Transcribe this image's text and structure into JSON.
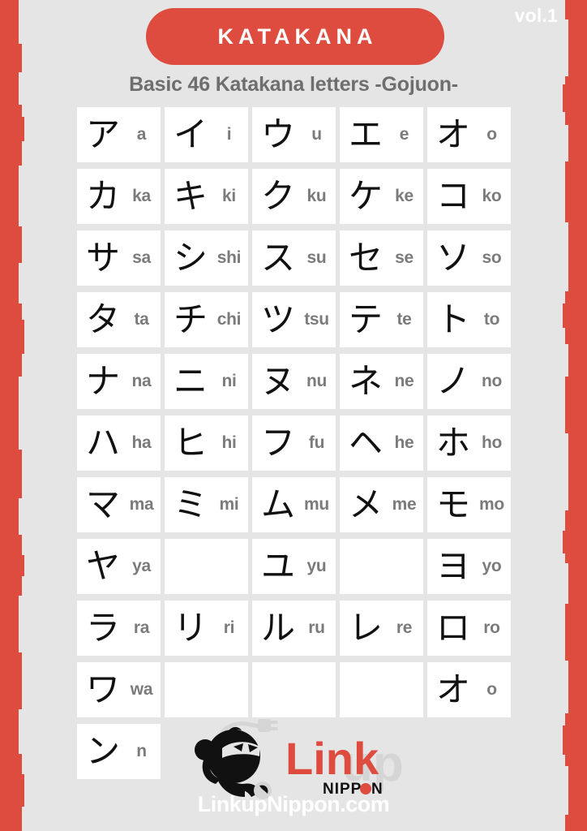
{
  "header": {
    "volume": "vol.1",
    "title": "KATAKANA",
    "subtitle": "Basic 46 Katakana letters -Gojuon-"
  },
  "colors": {
    "background": "#e6e5e5",
    "accent_red": "#dd4c3e",
    "cell_background": "#ffffff",
    "kana_text": "#111111",
    "romaji_text": "#7b7b7b",
    "subtitle_text": "#6e6e6e",
    "logo_black": "#111111",
    "logo_gray": "#d6d5d5"
  },
  "grid": {
    "columns": 5,
    "rows": [
      {
        "cells": [
          {
            "kana": "ア",
            "romaji": "a"
          },
          {
            "kana": "イ",
            "romaji": "i"
          },
          {
            "kana": "ウ",
            "romaji": "u"
          },
          {
            "kana": "エ",
            "romaji": "e"
          },
          {
            "kana": "オ",
            "romaji": "o"
          }
        ]
      },
      {
        "cells": [
          {
            "kana": "カ",
            "romaji": "ka"
          },
          {
            "kana": "キ",
            "romaji": "ki"
          },
          {
            "kana": "ク",
            "romaji": "ku"
          },
          {
            "kana": "ケ",
            "romaji": "ke"
          },
          {
            "kana": "コ",
            "romaji": "ko"
          }
        ]
      },
      {
        "cells": [
          {
            "kana": "サ",
            "romaji": "sa"
          },
          {
            "kana": "シ",
            "romaji": "shi"
          },
          {
            "kana": "ス",
            "romaji": "su"
          },
          {
            "kana": "セ",
            "romaji": "se"
          },
          {
            "kana": "ソ",
            "romaji": "so"
          }
        ]
      },
      {
        "cells": [
          {
            "kana": "タ",
            "romaji": "ta"
          },
          {
            "kana": "チ",
            "romaji": "chi"
          },
          {
            "kana": "ツ",
            "romaji": "tsu"
          },
          {
            "kana": "テ",
            "romaji": "te"
          },
          {
            "kana": "ト",
            "romaji": "to"
          }
        ]
      },
      {
        "cells": [
          {
            "kana": "ナ",
            "romaji": "na"
          },
          {
            "kana": "ニ",
            "romaji": "ni"
          },
          {
            "kana": "ヌ",
            "romaji": "nu"
          },
          {
            "kana": "ネ",
            "romaji": "ne"
          },
          {
            "kana": "ノ",
            "romaji": "no"
          }
        ]
      },
      {
        "cells": [
          {
            "kana": "ハ",
            "romaji": "ha"
          },
          {
            "kana": "ヒ",
            "romaji": "hi"
          },
          {
            "kana": "フ",
            "romaji": "fu"
          },
          {
            "kana": "ヘ",
            "romaji": "he"
          },
          {
            "kana": "ホ",
            "romaji": "ho"
          }
        ]
      },
      {
        "cells": [
          {
            "kana": "マ",
            "romaji": "ma"
          },
          {
            "kana": "ミ",
            "romaji": "mi"
          },
          {
            "kana": "ム",
            "romaji": "mu"
          },
          {
            "kana": "メ",
            "romaji": "me"
          },
          {
            "kana": "モ",
            "romaji": "mo"
          }
        ]
      },
      {
        "cells": [
          {
            "kana": "ヤ",
            "romaji": "ya"
          },
          {
            "kana": "",
            "romaji": ""
          },
          {
            "kana": "ユ",
            "romaji": "yu"
          },
          {
            "kana": "",
            "romaji": ""
          },
          {
            "kana": "ヨ",
            "romaji": "yo"
          }
        ]
      },
      {
        "cells": [
          {
            "kana": "ラ",
            "romaji": "ra"
          },
          {
            "kana": "リ",
            "romaji": "ri"
          },
          {
            "kana": "ル",
            "romaji": "ru"
          },
          {
            "kana": "レ",
            "romaji": "re"
          },
          {
            "kana": "ロ",
            "romaji": "ro"
          }
        ]
      },
      {
        "cells": [
          {
            "kana": "ワ",
            "romaji": "wa"
          },
          {
            "kana": "",
            "romaji": ""
          },
          {
            "kana": "",
            "romaji": ""
          },
          {
            "kana": "",
            "romaji": ""
          },
          {
            "kana": "オ",
            "romaji": "o"
          }
        ]
      },
      {
        "cells": [
          {
            "kana": "ン",
            "romaji": "n"
          },
          {
            "kana": null,
            "romaji": null
          },
          {
            "kana": null,
            "romaji": null
          },
          {
            "kana": null,
            "romaji": null
          },
          {
            "kana": null,
            "romaji": null
          }
        ]
      }
    ]
  },
  "footer": {
    "logo": {
      "mascot_name": "ninja-plug-mascot",
      "word_link": "Link",
      "word_up": "up",
      "word_nippon": "NIPPON"
    },
    "url": "LinkupNippon.com"
  }
}
